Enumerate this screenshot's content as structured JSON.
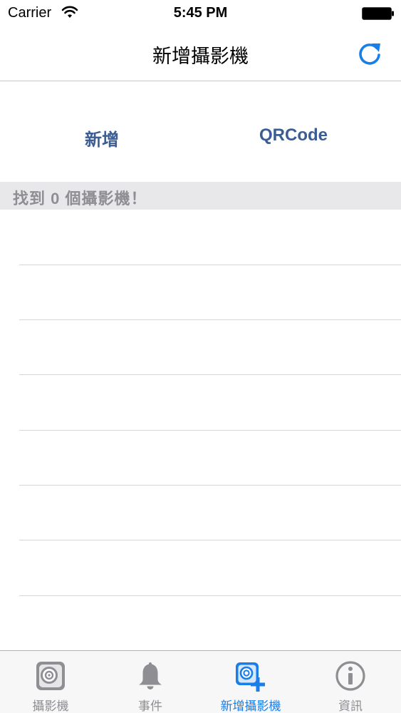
{
  "status_bar": {
    "carrier": "Carrier",
    "time": "5:45 PM"
  },
  "nav": {
    "title": "新增攝影機",
    "refresh_icon": "refresh-icon"
  },
  "actions": {
    "add_label": "新增",
    "qr_label": "QRCode"
  },
  "section": {
    "found_text": "找到 0 個攝影機！"
  },
  "list": {
    "rows": 8
  },
  "tabs": [
    {
      "label": "攝影機",
      "icon": "camera-icon",
      "active": false
    },
    {
      "label": "事件",
      "icon": "bell-icon",
      "active": false
    },
    {
      "label": "新增攝影機",
      "icon": "add-camera-icon",
      "active": true
    },
    {
      "label": "資訊",
      "icon": "info-icon",
      "active": false
    }
  ],
  "colors": {
    "accent": "#1a7ee8",
    "button_text": "#3b5d93",
    "section_bg": "#e8e8ea",
    "inactive": "#8e8e93"
  }
}
